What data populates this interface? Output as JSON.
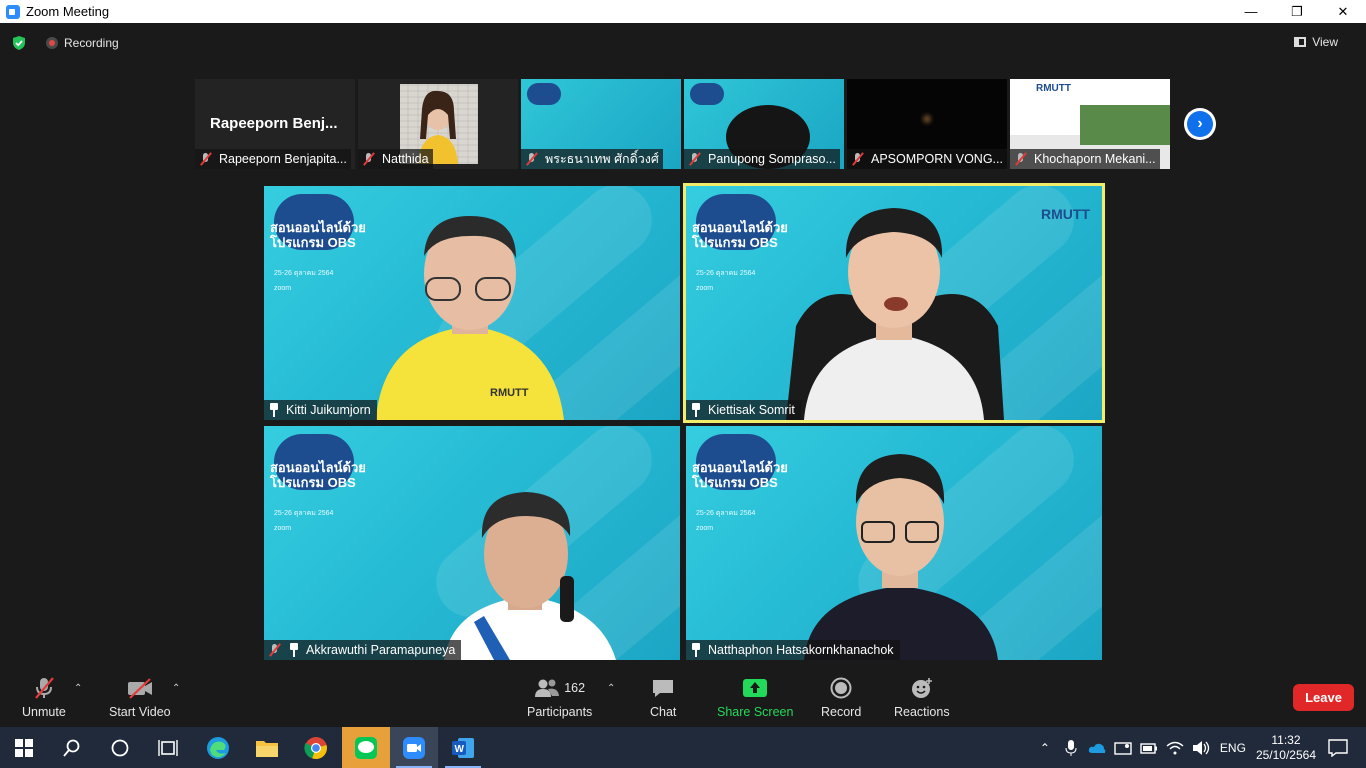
{
  "window": {
    "title": "Zoom Meeting"
  },
  "top_bar": {
    "recording_label": "Recording",
    "view_label": "View"
  },
  "strip": [
    {
      "name": "Rapeeporn Benjapita...",
      "big_name": "Rapeeporn  Benj...",
      "kind": "name"
    },
    {
      "name": "Natthida",
      "kind": "camera"
    },
    {
      "name": "พระธนาเทพ ศักดิ์วงศ์",
      "kind": "obs"
    },
    {
      "name": "Panupong Somprasо...",
      "kind": "obs"
    },
    {
      "name": "APSOMPORN VONG...",
      "kind": "black"
    },
    {
      "name": "Khochaporn Mekani...",
      "kind": "rmutt"
    }
  ],
  "gallery": [
    {
      "name": "Kitti Juikumjorn",
      "shirt": "#f5e23a"
    },
    {
      "name": "Kiettisak Somrit",
      "shirt": "#f2f2f2"
    },
    {
      "name": "Akkrawuthi Paramapuneya",
      "shirt": "#ffffff"
    },
    {
      "name": "Natthaphon Hatsakornkhanachok",
      "shirt": "#1c1c2a"
    }
  ],
  "background": {
    "logo_line1": "สอนออนไลน์ด้วย",
    "logo_line2": "โปรแกรม OBS",
    "date_line": "25-26 ตุลาคม 2564",
    "platform": "zoom",
    "brand": "RMUTT"
  },
  "toolbar": {
    "unmute": "Unmute",
    "start_video": "Start Video",
    "participants": "Participants",
    "participant_count": "162",
    "chat": "Chat",
    "share_screen": "Share Screen",
    "record": "Record",
    "reactions": "Reactions",
    "leave": "Leave"
  },
  "taskbar": {
    "language": "ENG",
    "time": "11:32",
    "date": "25/10/2564"
  },
  "colors": {
    "accent_blue": "#0e71eb",
    "share_green": "#23d959",
    "leave_red": "#e02828",
    "active_speaker": "#f2ec6b"
  }
}
